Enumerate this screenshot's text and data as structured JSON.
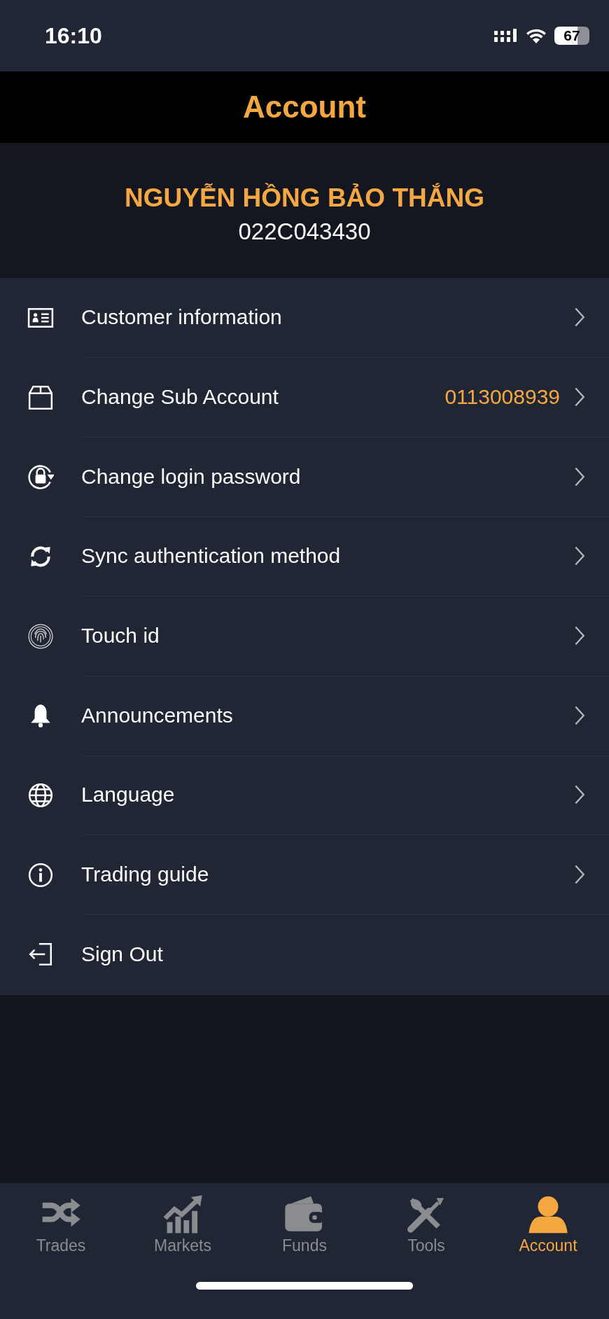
{
  "status_bar": {
    "time": "16:10",
    "battery": "67"
  },
  "header": {
    "title": "Account"
  },
  "profile": {
    "name": "NGUYỄN HỒNG BẢO THẮNG",
    "id": "022C043430"
  },
  "menu": {
    "items": [
      {
        "label": "Customer information",
        "chevron": true
      },
      {
        "label": "Change Sub Account",
        "value": "0113008939",
        "chevron": true
      },
      {
        "label": "Change login password",
        "chevron": true
      },
      {
        "label": "Sync authentication method",
        "chevron": true
      },
      {
        "label": "Touch id",
        "chevron": true
      },
      {
        "label": "Announcements",
        "chevron": true
      },
      {
        "label": "Language",
        "chevron": true
      },
      {
        "label": "Trading guide",
        "chevron": true
      },
      {
        "label": "Sign Out",
        "chevron": false
      }
    ]
  },
  "tab_bar": {
    "tabs": [
      {
        "label": "Trades",
        "selected": false
      },
      {
        "label": "Markets",
        "selected": false
      },
      {
        "label": "Funds",
        "selected": false
      },
      {
        "label": "Tools",
        "selected": false
      },
      {
        "label": "Account",
        "selected": true
      }
    ]
  }
}
